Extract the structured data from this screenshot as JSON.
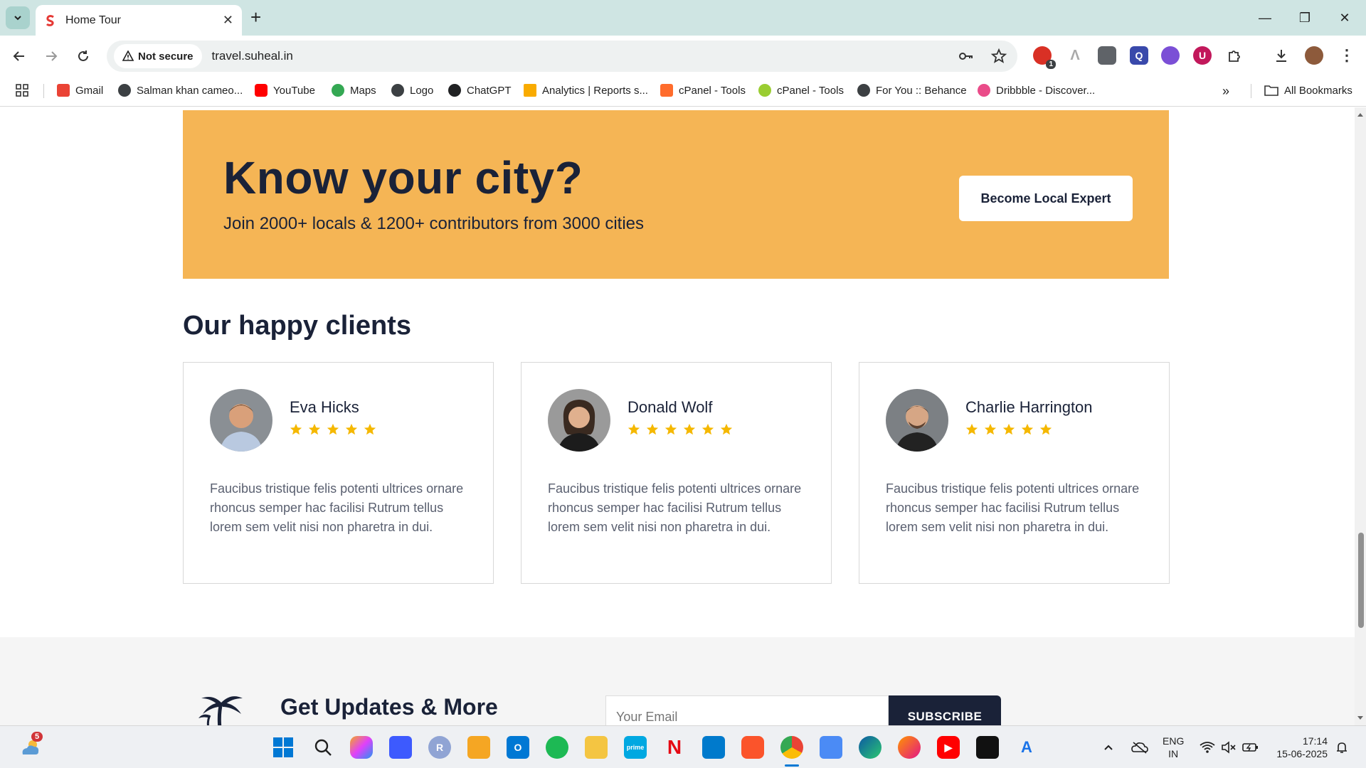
{
  "browser": {
    "tab_title": "Home Tour",
    "not_secure_label": "Not secure",
    "url": "travel.suheal.in",
    "extension_badge_count": "1",
    "bookmarks": [
      {
        "label": "Gmail",
        "color": "#ea4335"
      },
      {
        "label": "Salman khan cameo...",
        "color": "#3c4043"
      },
      {
        "label": "YouTube",
        "color": "#ff0000"
      },
      {
        "label": "Maps",
        "color": "#34a853"
      },
      {
        "label": "Logo",
        "color": "#3c4043"
      },
      {
        "label": "ChatGPT",
        "color": "#202123"
      },
      {
        "label": "Analytics | Reports s...",
        "color": "#f9ab00"
      },
      {
        "label": "cPanel - Tools",
        "color": "#ff6c2c"
      },
      {
        "label": "cPanel - Tools",
        "color": "#9acd32"
      },
      {
        "label": "For You :: Behance",
        "color": "#3c4043"
      },
      {
        "label": "Dribbble - Discover...",
        "color": "#ea4c89"
      }
    ],
    "all_bookmarks_label": "All Bookmarks"
  },
  "page": {
    "cta": {
      "heading": "Know your city?",
      "subtext": "Join 2000+ locals & 1200+ contributors from 3000 cities",
      "button_label": "Become Local Expert",
      "background": "#f5b555"
    },
    "clients_title": "Our happy clients",
    "testimonials": [
      {
        "name": "Eva Hicks",
        "rating": 5,
        "text": "Faucibus tristique felis potenti ultrices ornare rhoncus semper hac facilisi Rutrum tellus lorem sem velit nisi non pharetra in dui."
      },
      {
        "name": "Donald Wolf",
        "rating": 6,
        "text": "Faucibus tristique felis potenti ultrices ornare rhoncus semper hac facilisi Rutrum tellus lorem sem velit nisi non pharetra in dui."
      },
      {
        "name": "Charlie Harrington",
        "rating": 5,
        "text": "Faucibus tristique felis potenti ultrices ornare rhoncus semper hac facilisi Rutrum tellus lorem sem velit nisi non pharetra in dui."
      }
    ],
    "updates": {
      "title": "Get Updates & More",
      "email_placeholder": "Your Email",
      "subscribe_label": "SUBSCRIBE"
    }
  },
  "taskbar": {
    "weather_badge": "5",
    "language": "ENG",
    "region": "IN",
    "time": "17:14",
    "date": "15-06-2025"
  }
}
